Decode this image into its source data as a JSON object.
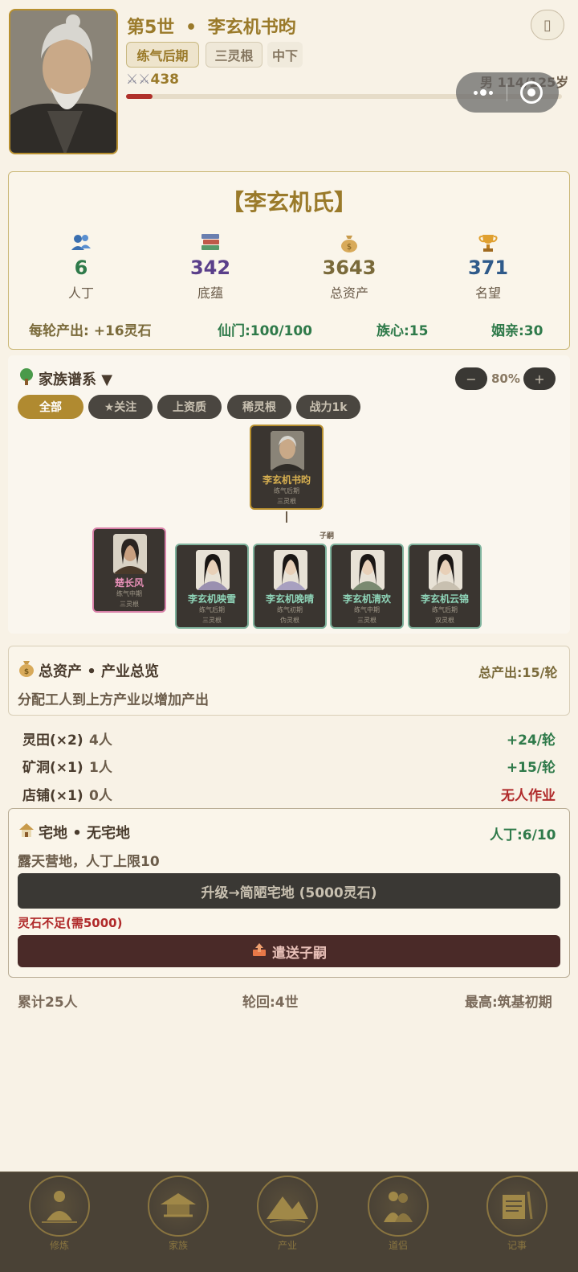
{
  "header": {
    "generation": "第5世",
    "dot": "•",
    "name": "李玄机书昀",
    "realm_tag": "练气后期",
    "root_tag": "三灵根",
    "grade_tag": "中下",
    "power": "438",
    "gender_age": "男 114/125岁",
    "menu_glyph": "▯",
    "age_progress": 0.06
  },
  "clan": {
    "title": "【李玄机氏】",
    "stats": [
      {
        "value": "6",
        "label": "人丁",
        "icon": "people-icon",
        "color": "#2f7a4a"
      },
      {
        "value": "342",
        "label": "底蕴",
        "icon": "books-icon",
        "color": "#5a3f8a"
      },
      {
        "value": "3643",
        "label": "总资产",
        "icon": "money-bag-icon",
        "color": "#7a6a3a"
      },
      {
        "value": "371",
        "label": "名望",
        "icon": "trophy-icon",
        "color": "#2f5a8a"
      }
    ],
    "output": "每轮产出: +16灵石",
    "immortal_gate": "仙门:100/100",
    "clan_heart": "族心:15",
    "marriage": "姻亲:30"
  },
  "tree": {
    "title": "家族谱系 ▼",
    "zoom": "80%",
    "minus": "−",
    "plus": "+",
    "filters": [
      "全部",
      "★关注",
      "上资质",
      "稀灵根",
      "战力1k"
    ],
    "heir_label": "子嗣",
    "root": {
      "name": "李玄机书昀",
      "realm": "练气后期",
      "root": "三灵根"
    },
    "spouse": {
      "name": "楚长风",
      "realm": "练气中期",
      "root": "三灵根"
    },
    "children": [
      {
        "name": "李玄机映雪",
        "realm": "练气后期",
        "root": "三灵根"
      },
      {
        "name": "李玄机晚晴",
        "realm": "练气初期",
        "root": "伪灵根"
      },
      {
        "name": "李玄机清欢",
        "realm": "练气中期",
        "root": "三灵根"
      },
      {
        "name": "李玄机云锦",
        "realm": "练气后期",
        "root": "双灵根"
      }
    ]
  },
  "assets": {
    "title": "总资产 • 产业总览",
    "total_output": "总产出:15/轮",
    "hint": "分配工人到上方产业以增加产出"
  },
  "industries": [
    {
      "name": "灵田(×2)",
      "workers": "4人",
      "output": "+24/轮",
      "status_color": "#2f7a4a"
    },
    {
      "name": "矿洞(×1)",
      "workers": "1人",
      "output": "+15/轮",
      "status_color": "#2f7a4a"
    },
    {
      "name": "店铺(×1)",
      "workers": "0人",
      "output": "无人作业",
      "status_color": "#b02a2a"
    }
  ],
  "residence": {
    "title": "宅地 • 无宅地",
    "population": "人丁:6/10",
    "desc": "露天营地，人丁上限10",
    "upgrade_button": "升级→简陋宅地 (5000灵石)",
    "warning": "灵石不足(需5000)",
    "send_button": "遣送子嗣"
  },
  "footer": {
    "total": "累计25人",
    "reincarnation": "轮回:4世",
    "highest": "最高:筑基初期"
  },
  "nav": [
    {
      "label": "修炼",
      "icon": "meditation-icon"
    },
    {
      "label": "家族",
      "icon": "pavilion-icon"
    },
    {
      "label": "产业",
      "icon": "mountain-icon"
    },
    {
      "label": "道侣",
      "icon": "couple-icon"
    },
    {
      "label": "记事",
      "icon": "scroll-icon"
    }
  ]
}
